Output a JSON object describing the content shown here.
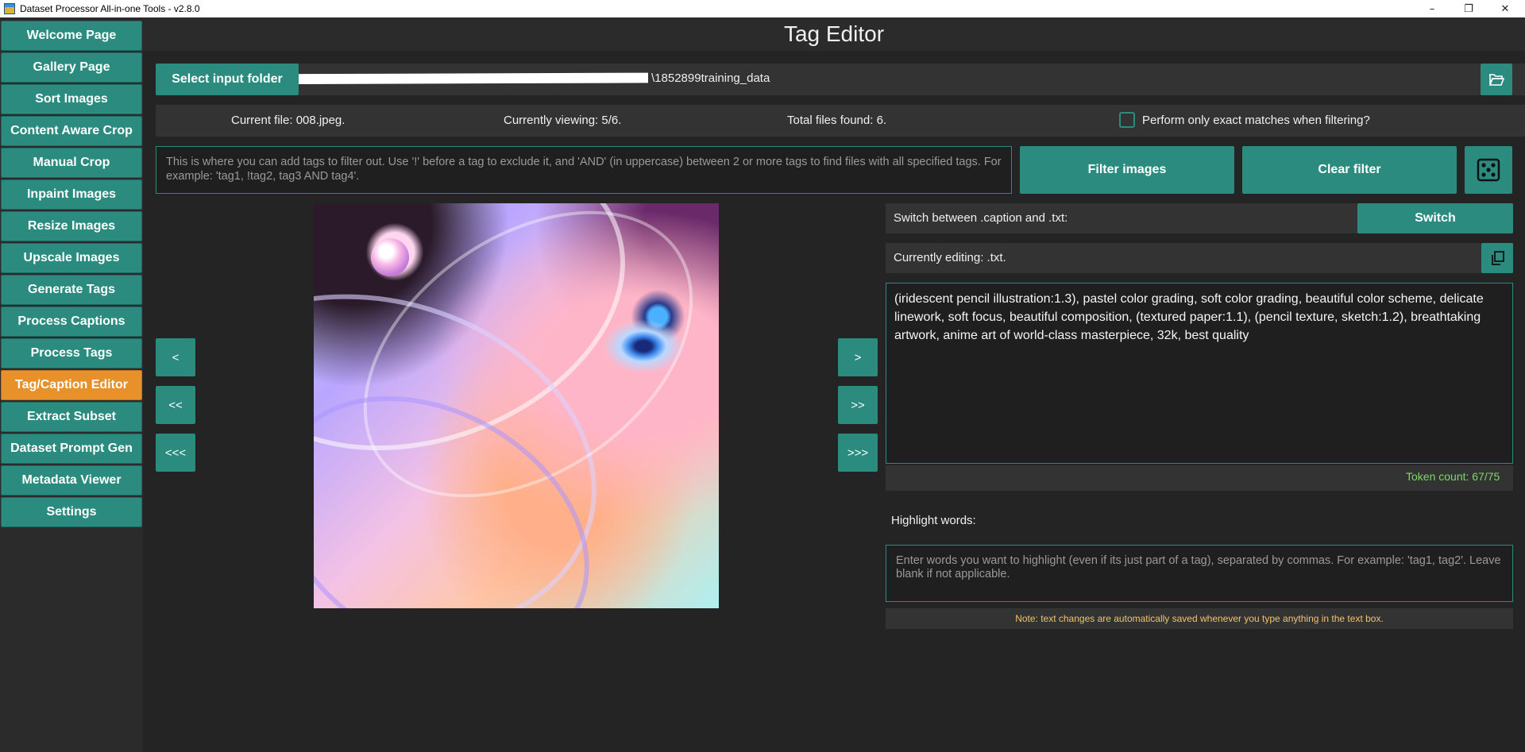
{
  "window": {
    "title": "Dataset Processor All-in-one Tools - v2.8.0",
    "controls": {
      "minimize": "–",
      "maximize": "❐",
      "close": "✕"
    }
  },
  "sidebar": {
    "items": [
      {
        "label": "Welcome Page"
      },
      {
        "label": "Gallery Page"
      },
      {
        "label": "Sort Images"
      },
      {
        "label": "Content Aware Crop"
      },
      {
        "label": "Manual Crop"
      },
      {
        "label": "Inpaint Images"
      },
      {
        "label": "Resize Images"
      },
      {
        "label": "Upscale Images"
      },
      {
        "label": "Generate Tags"
      },
      {
        "label": "Process Captions"
      },
      {
        "label": "Process Tags"
      },
      {
        "label": "Tag/Caption Editor"
      },
      {
        "label": "Extract Subset"
      },
      {
        "label": "Dataset Prompt Gen"
      },
      {
        "label": "Metadata Viewer"
      },
      {
        "label": "Settings"
      }
    ],
    "active_index": 11
  },
  "main": {
    "title": "Tag Editor",
    "folder": {
      "button_label": "Select input folder",
      "path_suffix": "\\1852899training_data",
      "browse_icon": "folder-open-icon"
    },
    "info": {
      "current_file": "Current file: 008.jpeg.",
      "currently_viewing": "Currently viewing: 5/6.",
      "total_files": "Total files found: 6.",
      "exact_match_label": "Perform only exact matches when filtering?"
    },
    "filter": {
      "placeholder": "This is where you can add tags to filter out. Use '!' before a tag to exclude it, and 'AND' (in uppercase) between 2 or more tags to find files with all specified tags. For example: 'tag1, !tag2, tag3 AND tag4'.",
      "filter_button": "Filter images",
      "clear_button": "Clear filter",
      "random_icon": "dice-icon"
    },
    "navigation": {
      "prev": "<",
      "prev_more": "<<",
      "prev_most": "<<<",
      "next": ">",
      "next_more": ">>",
      "next_most": ">>>"
    },
    "editor": {
      "switch_label": "Switch between .caption and .txt:",
      "switch_button": "Switch",
      "currently_editing": "Currently editing: .txt.",
      "copy_icon": "copy-icon",
      "text": "(iridescent pencil illustration:1.3), pastel color grading, soft color grading, beautiful color scheme, delicate linework, soft focus, beautiful composition, (textured paper:1.1), (pencil texture, sketch:1.2), breathtaking artwork, anime art of world-class masterpiece, 32k, best quality",
      "token_count": "Token count: 67/75"
    },
    "highlight": {
      "label": "Highlight words:",
      "placeholder": "Enter words you want to highlight (even if its just part of a tag), separated by commas. For example: 'tag1, tag2'. Leave blank if not applicable."
    },
    "note": "Note: text changes are automatically saved whenever you type anything in the text box."
  },
  "colors": {
    "accent": "#2a8b7e",
    "active": "#e8902a",
    "token": "#7cd86a",
    "note": "#f2c26a"
  }
}
